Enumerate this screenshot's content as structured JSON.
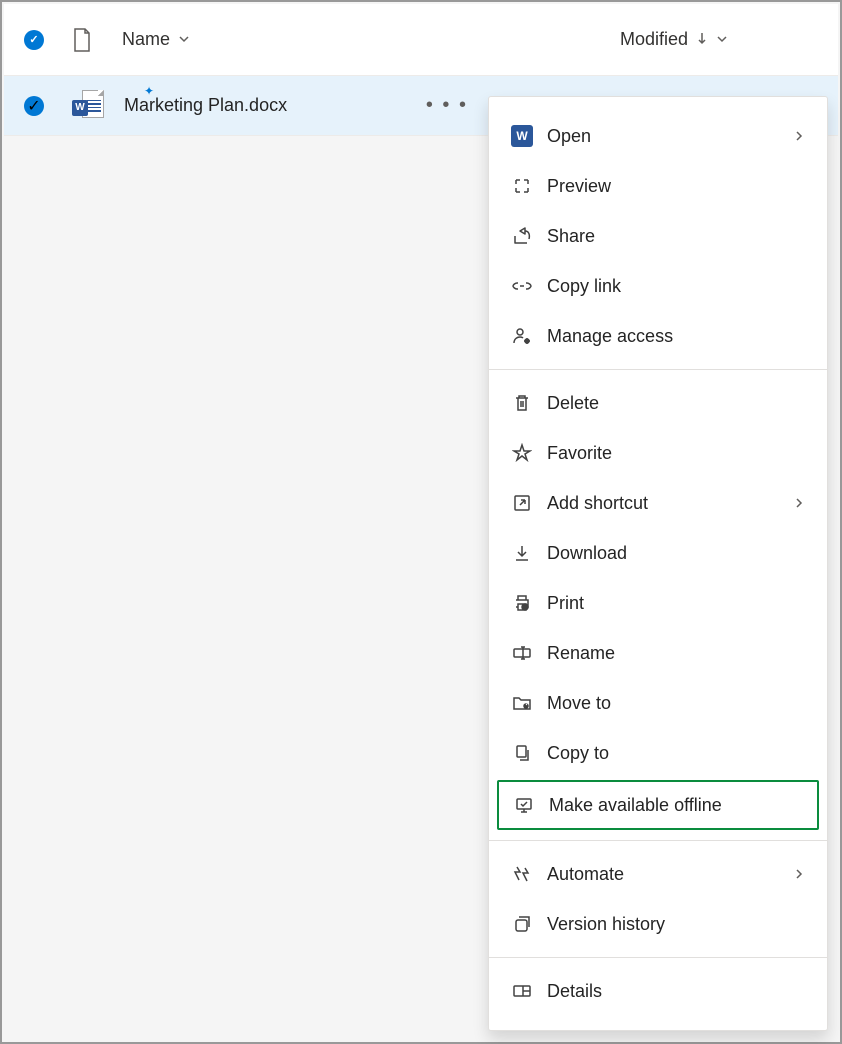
{
  "header": {
    "name_col": "Name",
    "modified_col": "Modified"
  },
  "row": {
    "filename": "Marketing Plan.docx"
  },
  "menu": {
    "open": "Open",
    "preview": "Preview",
    "share": "Share",
    "copy_link": "Copy link",
    "manage_access": "Manage access",
    "delete": "Delete",
    "favorite": "Favorite",
    "add_shortcut": "Add shortcut",
    "download": "Download",
    "print": "Print",
    "rename": "Rename",
    "move_to": "Move to",
    "copy_to": "Copy to",
    "make_offline": "Make available offline",
    "automate": "Automate",
    "version_history": "Version history",
    "details": "Details"
  }
}
